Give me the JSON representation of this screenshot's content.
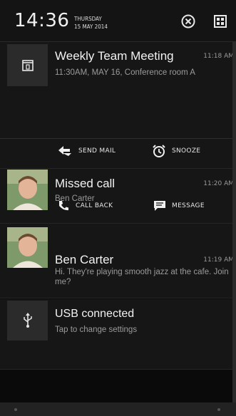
{
  "status": {
    "time": "14:36",
    "day": "THURSDAY",
    "date": "15 MAY 2014"
  },
  "header_icons": [
    "clear-all-icon",
    "settings-icon"
  ],
  "notifications": [
    {
      "type": "calendar",
      "icon": "calendar-icon",
      "title": "Weekly Team Meeting",
      "subtitle": "11:30AM, MAY 16, Conference room A",
      "time": "11:18 AM",
      "actions": [
        {
          "label": "SEND MAIL",
          "icon": "send-mail-icon"
        },
        {
          "label": "SNOOZE",
          "icon": "alarm-icon"
        }
      ]
    },
    {
      "type": "missed-call",
      "icon": "avatar",
      "title": "Missed call",
      "subtitle": "Ben Carter",
      "time": "11:20 AM",
      "actions": [
        {
          "label": "CALL BACK",
          "icon": "phone-icon"
        },
        {
          "label": "MESSAGE",
          "icon": "message-icon"
        }
      ]
    },
    {
      "type": "message",
      "icon": "avatar",
      "title": "Ben Carter",
      "subtitle": "Hi. They're playing smooth jazz at the cafe. Join me?",
      "time": "11:19 AM"
    },
    {
      "type": "usb",
      "icon": "usb-icon",
      "title": "USB connected",
      "subtitle": "Tap to change settings"
    }
  ],
  "colors": {
    "background": "#0a0a0a",
    "card": "#161616",
    "icon_tile": "#2b2b2b",
    "watermark": "#8a0f8f"
  }
}
